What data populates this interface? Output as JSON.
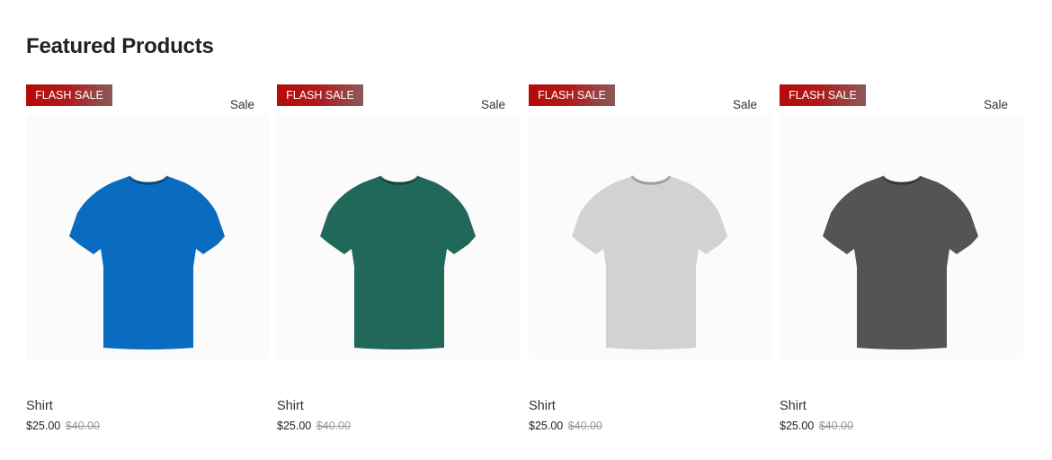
{
  "section": {
    "title": "Featured Products"
  },
  "products": [
    {
      "badge": "FLASH SALE",
      "sale_label": "Sale",
      "name": "Shirt",
      "price": "$25.00",
      "old_price": "$40.00",
      "color": "#0a6cc0"
    },
    {
      "badge": "FLASH SALE",
      "sale_label": "Sale",
      "name": "Shirt",
      "price": "$25.00",
      "old_price": "$40.00",
      "color": "#22685a"
    },
    {
      "badge": "FLASH SALE",
      "sale_label": "Sale",
      "name": "Shirt",
      "price": "$25.00",
      "old_price": "$40.00",
      "color": "#d2d2d2"
    },
    {
      "badge": "FLASH SALE",
      "sale_label": "Sale",
      "name": "Shirt",
      "price": "$25.00",
      "old_price": "$40.00",
      "color": "#545457"
    }
  ]
}
